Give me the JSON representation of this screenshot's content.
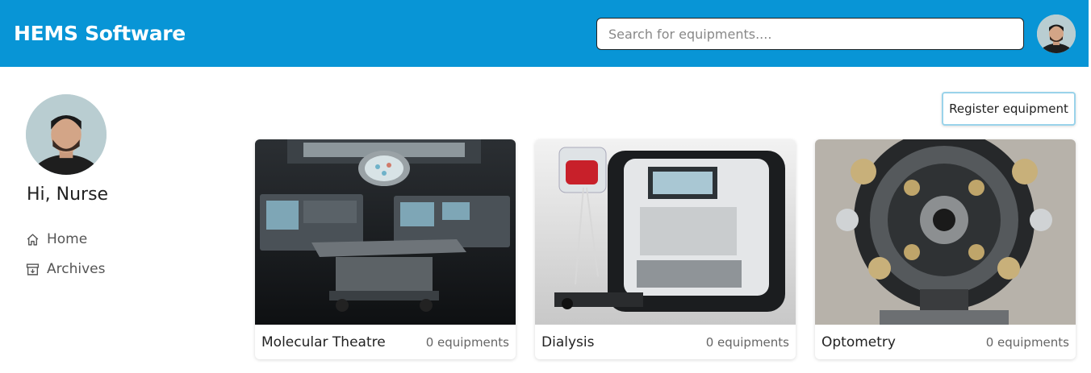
{
  "header": {
    "brand": "HEMS Software",
    "search_placeholder": "Search for equipments....",
    "search_value": ""
  },
  "sidebar": {
    "greeting": "Hi, Nurse",
    "items": [
      {
        "label": "Home",
        "icon": "home-icon"
      },
      {
        "label": "Archives",
        "icon": "archive-icon"
      }
    ]
  },
  "main": {
    "register_label": "Register equipment",
    "cards": [
      {
        "name": "Molecular Theatre",
        "count": "0 equipments"
      },
      {
        "name": "Dialysis",
        "count": "0 equipments"
      },
      {
        "name": "Optometry",
        "count": "0 equipments"
      }
    ]
  },
  "colors": {
    "header_bg": "#0895d6",
    "button_border": "#9ad3ea"
  }
}
